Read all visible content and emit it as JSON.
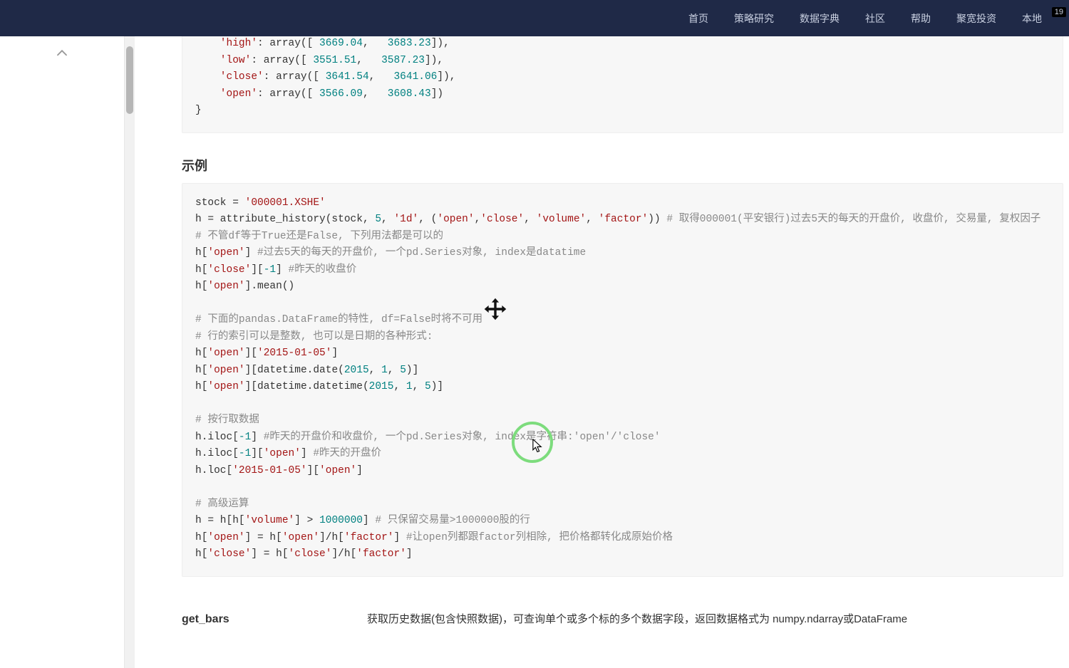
{
  "nav": {
    "items": [
      "首页",
      "策略研究",
      "数据字典",
      "社区",
      "帮助",
      "聚宽投资",
      "本地"
    ],
    "badge": "19"
  },
  "code1": {
    "l1a": "    'high'",
    "l1b": ": array([ ",
    "l1c": "3669.04",
    "l1d": ",   ",
    "l1e": "3683.23",
    "l1f": "]),",
    "l2a": "    'low'",
    "l2b": ": array([ ",
    "l2c": "3551.51",
    "l2d": ",   ",
    "l2e": "3587.23",
    "l2f": "]),",
    "l3a": "    'close'",
    "l3b": ": array([ ",
    "l3c": "3641.54",
    "l3d": ",   ",
    "l3e": "3641.06",
    "l3f": "]),",
    "l4a": "    'open'",
    "l4b": ": array([ ",
    "l4c": "3566.09",
    "l4d": ",   ",
    "l4e": "3608.43",
    "l4f": "])",
    "l5": "}"
  },
  "section": "示例",
  "code2": {
    "r1a": "stock = ",
    "r1b": "'000001.XSHE'",
    "r2a": "h = attribute_history(stock, ",
    "r2b": "5",
    "r2c": ", ",
    "r2d": "'1d'",
    "r2e": ", (",
    "r2f": "'open'",
    "r2g": ",",
    "r2h": "'close'",
    "r2i": ", ",
    "r2j": "'volume'",
    "r2k": ", ",
    "r2l": "'factor'",
    "r2m": ")) ",
    "r2n": "# 取得000001(平安银行)过去5天的每天的开盘价, 收盘价, 交易量, 复权因子",
    "r3": "# 不管df等于True还是False, 下列用法都是可以的",
    "r4a": "h[",
    "r4b": "'open'",
    "r4c": "] ",
    "r4d": "#过去5天的每天的开盘价, 一个pd.Series对象, index是datatime",
    "r5a": "h[",
    "r5b": "'close'",
    "r5c": "][",
    "r5d": "-1",
    "r5e": "] ",
    "r5f": "#昨天的收盘价",
    "r6a": "h[",
    "r6b": "'open'",
    "r6c": "].mean()",
    "r7": "# 下面的pandas.DataFrame的特性, df=False时将不可用",
    "r8": "# 行的索引可以是整数, 也可以是日期的各种形式:",
    "r9a": "h[",
    "r9b": "'open'",
    "r9c": "][",
    "r9d": "'2015-01-05'",
    "r9e": "]",
    "r10a": "h[",
    "r10b": "'open'",
    "r10c": "][datetime.date(",
    "r10d": "2015",
    "r10e": ", ",
    "r10f": "1",
    "r10g": ", ",
    "r10h": "5",
    "r10i": ")]",
    "r11a": "h[",
    "r11b": "'open'",
    "r11c": "][datetime.datetime(",
    "r11d": "2015",
    "r11e": ", ",
    "r11f": "1",
    "r11g": ", ",
    "r11h": "5",
    "r11i": ")]",
    "r12": "# 按行取数据",
    "r13a": "h.iloc[",
    "r13b": "-1",
    "r13c": "] ",
    "r13d": "#昨天的开盘价和收盘价, 一个pd.Series对象, index是字符串:'open'/'close'",
    "r14a": "h.iloc[",
    "r14b": "-1",
    "r14c": "][",
    "r14d": "'open'",
    "r14e": "] ",
    "r14f": "#昨天的开盘价",
    "r15a": "h.loc[",
    "r15b": "'2015-01-05'",
    "r15c": "][",
    "r15d": "'open'",
    "r15e": "]",
    "r16": "# 高级运算",
    "r17a": "h = h[h[",
    "r17b": "'volume'",
    "r17c": "] > ",
    "r17d": "1000000",
    "r17e": "] ",
    "r17f": "# 只保留交易量>1000000股的行",
    "r18a": "h[",
    "r18b": "'open'",
    "r18c": "] = h[",
    "r18d": "'open'",
    "r18e": "]/h[",
    "r18f": "'factor'",
    "r18g": "] ",
    "r18h": "#让open列都跟factor列相除, 把价格都转化成原始价格",
    "r19a": "h[",
    "r19b": "'close'",
    "r19c": "] = h[",
    "r19d": "'close'",
    "r19e": "]/h[",
    "r19f": "'factor'",
    "r19g": "]"
  },
  "footer": {
    "name": "get_bars",
    "desc": "获取历史数据(包含快照数据)，可查询单个或多个标的多个数据字段，返回数据格式为 numpy.ndarray或DataFrame"
  }
}
